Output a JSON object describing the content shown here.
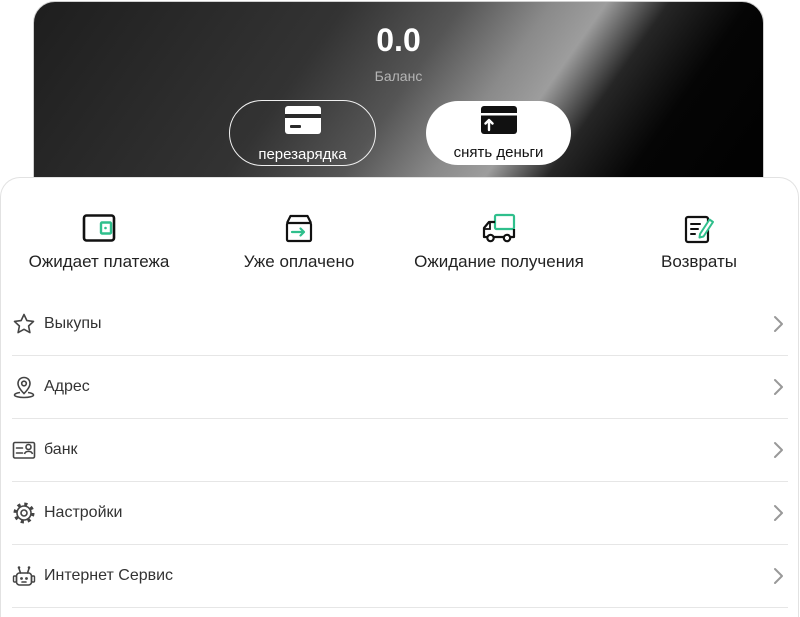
{
  "balance": {
    "amount": "0.0",
    "label": "Баланс"
  },
  "wallet_actions": [
    {
      "label": "перезарядка",
      "icon": "credit-card-icon"
    },
    {
      "label": "снять деньги",
      "icon": "card-withdraw-icon"
    }
  ],
  "orders": [
    {
      "label": "Ожидает платежа",
      "icon": "wallet-icon"
    },
    {
      "label": "Уже оплачено",
      "icon": "paid-box-icon"
    },
    {
      "label": "Ожидание получения",
      "icon": "delivery-truck-icon"
    },
    {
      "label": "Возвраты",
      "icon": "return-document-icon"
    }
  ],
  "menu": [
    {
      "label": "Выкупы",
      "icon": "star-icon"
    },
    {
      "label": "Адрес",
      "icon": "location-pin-icon"
    },
    {
      "label": "банк",
      "icon": "bank-card-icon"
    },
    {
      "label": "Настройки",
      "icon": "gear-icon"
    },
    {
      "label": "Интернет Сервис",
      "icon": "robot-icon"
    }
  ],
  "colors": {
    "accent": "#2fbf8c",
    "text": "#222222",
    "card_dark": "#111111",
    "divider": "#e6e6e6",
    "chevron": "#999999"
  }
}
